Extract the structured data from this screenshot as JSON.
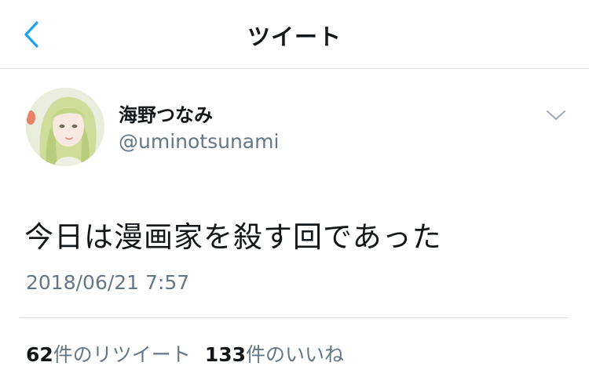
{
  "nav": {
    "title": "ツイート",
    "back_icon": "chevron-left-icon"
  },
  "tweet": {
    "display_name": "海野つなみ",
    "handle": "@uminotsunami",
    "text": "今日は漫画家を殺す回であった",
    "timestamp": "2018/06/21 7:57",
    "menu_icon": "chevron-down-icon"
  },
  "stats": {
    "retweets_count": "62",
    "retweets_label": "件のリツイート",
    "likes_count": "133",
    "likes_label": "件のいいね"
  },
  "colors": {
    "accent": "#1da1f2",
    "text": "#14171a",
    "secondary": "#657786",
    "divider": "#d8dce0"
  }
}
